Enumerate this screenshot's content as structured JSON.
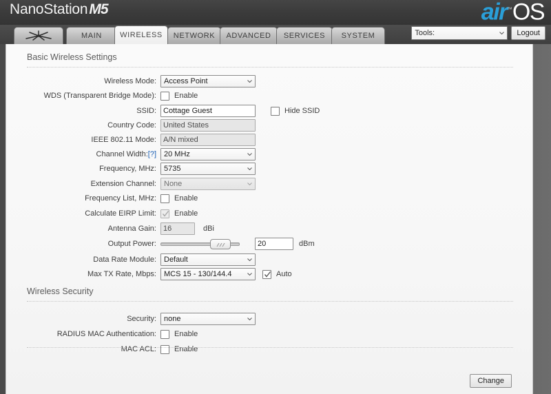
{
  "header": {
    "device_name": "NanoStation",
    "device_model": "M5",
    "logo_air": "air",
    "logo_os": "OS",
    "logo_tm": "™"
  },
  "tabs": [
    {
      "label": "",
      "icon": "ubiquiti-logo-icon",
      "active": false
    },
    {
      "label": "MAIN",
      "active": false
    },
    {
      "label": "WIRELESS",
      "active": true
    },
    {
      "label": "NETWORK",
      "active": false
    },
    {
      "label": "ADVANCED",
      "active": false
    },
    {
      "label": "SERVICES",
      "active": false
    },
    {
      "label": "SYSTEM",
      "active": false
    }
  ],
  "toolbar": {
    "tools_label": "Tools:",
    "logout_label": "Logout"
  },
  "sections": {
    "basic": {
      "title": "Basic Wireless Settings"
    },
    "security": {
      "title": "Wireless Security"
    }
  },
  "fields": {
    "wireless_mode": {
      "label": "Wireless Mode:",
      "value": "Access Point"
    },
    "wds": {
      "label": "WDS (Transparent Bridge Mode):",
      "checkbox_label": "Enable",
      "checked": false
    },
    "ssid": {
      "label": "SSID:",
      "value": "Cottage Guest",
      "hide_label": "Hide SSID",
      "hide_checked": false
    },
    "country_code": {
      "label": "Country Code:",
      "value": "United States"
    },
    "ieee_mode": {
      "label": "IEEE 802.11 Mode:",
      "value": "A/N mixed"
    },
    "channel_width": {
      "label": "Channel Width:",
      "help": "[?]",
      "value": "20 MHz"
    },
    "frequency": {
      "label": "Frequency, MHz:",
      "value": "5735"
    },
    "extension_channel": {
      "label": "Extension Channel:",
      "value": "None"
    },
    "frequency_list": {
      "label": "Frequency List, MHz:",
      "checkbox_label": "Enable",
      "checked": false
    },
    "eirp": {
      "label": "Calculate EIRP Limit:",
      "checkbox_label": "Enable",
      "checked": true
    },
    "antenna_gain": {
      "label": "Antenna Gain:",
      "value": "16",
      "unit": "dBi"
    },
    "output_power": {
      "label": "Output Power:",
      "value": "20",
      "unit": "dBm"
    },
    "data_rate_module": {
      "label": "Data Rate Module:",
      "value": "Default"
    },
    "max_tx_rate": {
      "label": "Max TX Rate, Mbps:",
      "value": "MCS 15 - 130/144.4",
      "auto_label": "Auto",
      "auto_checked": true
    },
    "security": {
      "label": "Security:",
      "value": "none"
    },
    "radius_mac_auth": {
      "label": "RADIUS MAC Authentication:",
      "checkbox_label": "Enable",
      "checked": false
    },
    "mac_acl": {
      "label": "MAC ACL:",
      "checkbox_label": "Enable",
      "checked": false
    }
  },
  "footer": {
    "change_label": "Change"
  },
  "colors": {
    "accent_blue": "#2a9fd8",
    "link_blue": "#1a5fb4",
    "header_dark": "#3c3c3c",
    "panel_bg": "#f7f7f7"
  }
}
